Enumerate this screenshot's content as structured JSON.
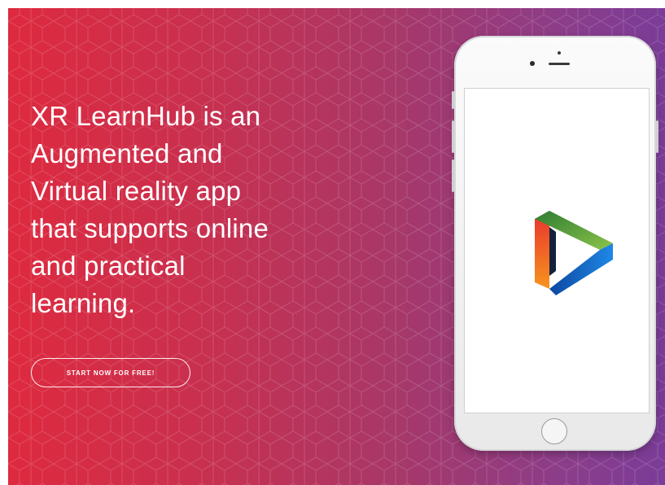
{
  "hero": {
    "headline_line1": "XR LearnHub is an",
    "headline_line2": "Augmented and",
    "headline_line3": "Virtual reality app",
    "headline_line4": "that supports online",
    "headline_line5": "and practical",
    "headline_line6": "learning.",
    "cta_label": "START NOW FOR FREE!"
  },
  "phone": {
    "screen_icon": "app-logo-icon"
  },
  "colors": {
    "gradient_start": "#de2a3f",
    "gradient_end": "#7a3c98",
    "text": "#ffffff"
  }
}
